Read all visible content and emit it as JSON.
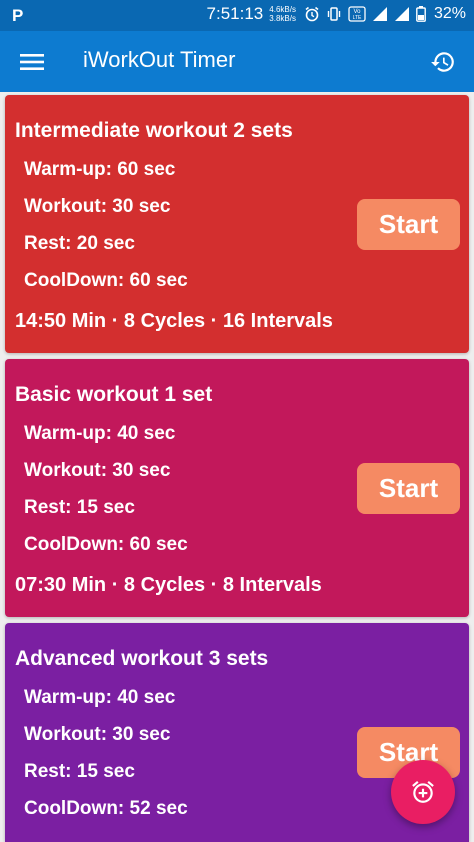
{
  "status_bar": {
    "left_icon": "P",
    "time": "7:51:13",
    "speed_up": "4.6kB/s",
    "speed_down": "3.8kB/s",
    "volte": "Vo LTE",
    "battery": "32%"
  },
  "app_bar": {
    "title": "iWorkOut Timer"
  },
  "workouts": [
    {
      "title": "Intermediate workout 2 sets",
      "warmup": "Warm-up: 60 sec",
      "workout": "Workout: 30 sec",
      "rest": "Rest: 20 sec",
      "cooldown": "CoolDown: 60 sec",
      "summary": "14:50 Min · 8 Cycles · 16 Intervals",
      "start_label": "Start",
      "color": "#d32f2f"
    },
    {
      "title": "Basic workout 1 set",
      "warmup": "Warm-up: 40 sec",
      "workout": "Workout: 30 sec",
      "rest": "Rest: 15 sec",
      "cooldown": "CoolDown: 60 sec",
      "summary": "07:30 Min · 8 Cycles · 8 Intervals",
      "start_label": "Start",
      "color": "#c2185b"
    },
    {
      "title": "Advanced workout 3 sets",
      "warmup": "Warm-up: 40 sec",
      "workout": "Workout: 30 sec",
      "rest": "Rest: 15 sec",
      "cooldown": "CoolDown: 52 sec",
      "start_label": "Start",
      "color": "#7b1fa2"
    }
  ],
  "icons": {
    "menu": "menu-icon",
    "history": "history-icon",
    "fab": "add-alarm-icon"
  },
  "colors": {
    "status_bar": "#0a68b2",
    "app_bar": "#0d7bd0",
    "start_button": "#f58a63",
    "fab": "#e91e63"
  }
}
